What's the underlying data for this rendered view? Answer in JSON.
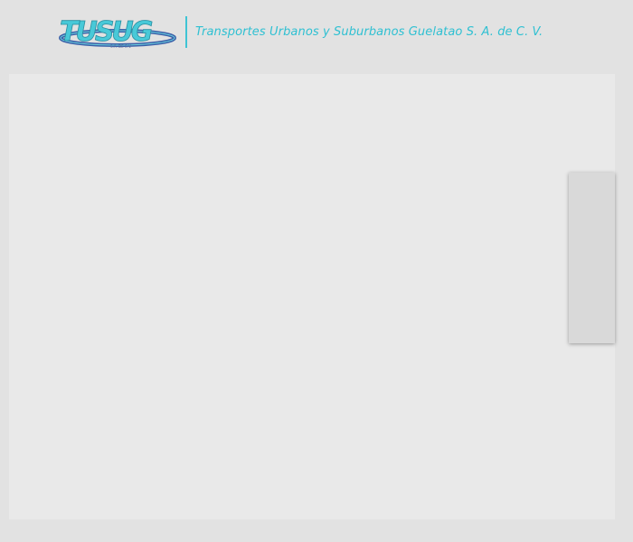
{
  "header": {
    "logo_text": "TUSUG",
    "company_name": "Transportes Urbanos y Suburbanos Guelatao S. A. de C. V."
  },
  "colors": {
    "background": "#e2e2e2",
    "content_panel": "#e9e9e9",
    "accent_cyan": "#2fc0d2",
    "logo_blue": "#3a5fa8"
  }
}
